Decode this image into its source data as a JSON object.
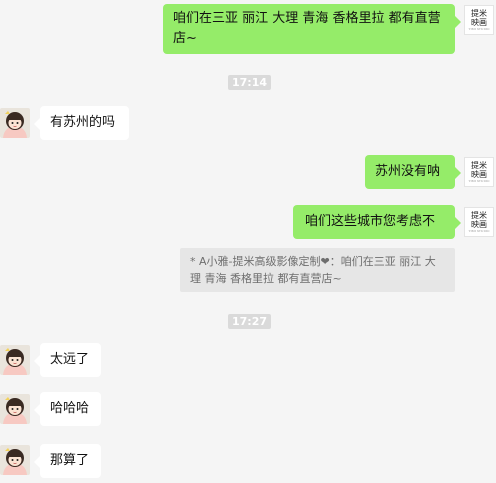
{
  "messages": {
    "m1": "咱们在三亚 丽江 大理 青海 香格里拉 都有直营店~",
    "ts1": "17:14",
    "m2": "有苏州的吗",
    "m3": "苏州没有呐",
    "m4": "咱们这些城市您考虑不",
    "quote": "*    A小雅-提米高级影像定制❤：咱们在三亚 丽江 大理 青海 香格里拉 都有直营店~",
    "ts2": "17:27",
    "m5": "太远了",
    "m6": "哈哈哈",
    "m7": "那算了"
  },
  "sender_avatar": {
    "line1": "提米",
    "line2": "映画",
    "sub": "TIMI STUDIO"
  },
  "colors": {
    "sent_bubble": "#95ec69",
    "recv_bubble": "#ffffff",
    "background": "#f5f5f5"
  }
}
